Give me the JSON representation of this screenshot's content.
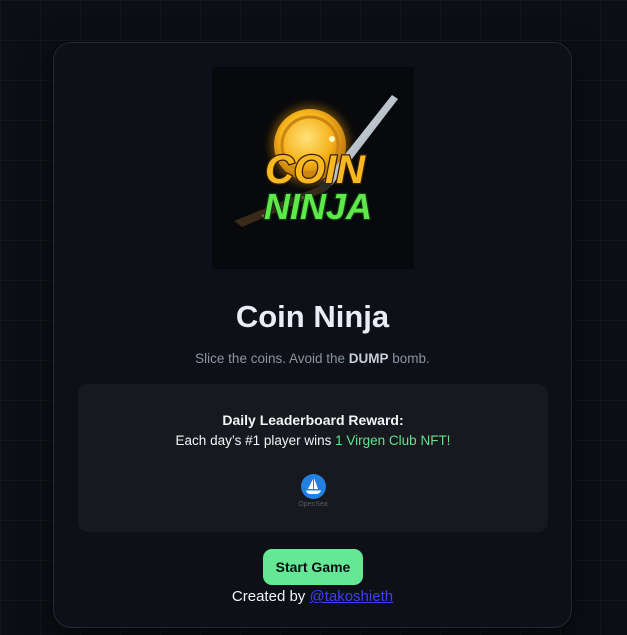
{
  "game": {
    "logo_lines": [
      "COIN",
      "NINJA"
    ],
    "title": "Coin Ninja",
    "subtitle_prefix": "Slice the coins. Avoid the ",
    "subtitle_highlight": "DUMP",
    "subtitle_suffix": " bomb."
  },
  "reward": {
    "heading": "Daily Leaderboard Reward:",
    "line_prefix": "Each day’s #1 player wins ",
    "line_prize": "1 Virgen Club NFT!",
    "marketplace_label": "OpenSea"
  },
  "actions": {
    "start_label": "Start Game"
  },
  "footer": {
    "credit_prefix": "Created by ",
    "credit_handle": "@takoshieth"
  },
  "colors": {
    "accent": "#64e896",
    "prize": "#5fe38d",
    "link": "#3d3dff",
    "opensea": "#2081e2",
    "coin": "#f5b21a"
  }
}
